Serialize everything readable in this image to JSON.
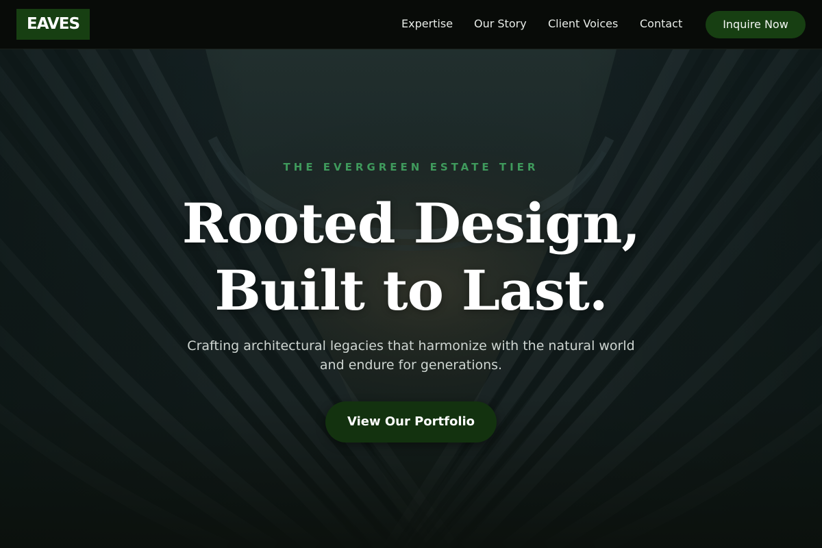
{
  "header": {
    "logo": "EAVES",
    "nav": [
      "Expertise",
      "Our Story",
      "Client Voices",
      "Contact"
    ],
    "cta_label": "Inquire Now"
  },
  "hero": {
    "eyebrow": "THE EVERGREEN ESTATE TIER",
    "headline_line1": "Rooted Design,",
    "headline_line2": "Built to Last.",
    "subtitle": "Crafting architectural legacies that harmonize with the natural world and endure for generations.",
    "button_label": "View Our Portfolio",
    "background_image": "curved-architecture-facade"
  },
  "colors": {
    "header_bg": "#080b08",
    "accent_green": "#173f12",
    "eyebrow_green": "#3f9a5c",
    "text_light": "#ffffff"
  }
}
